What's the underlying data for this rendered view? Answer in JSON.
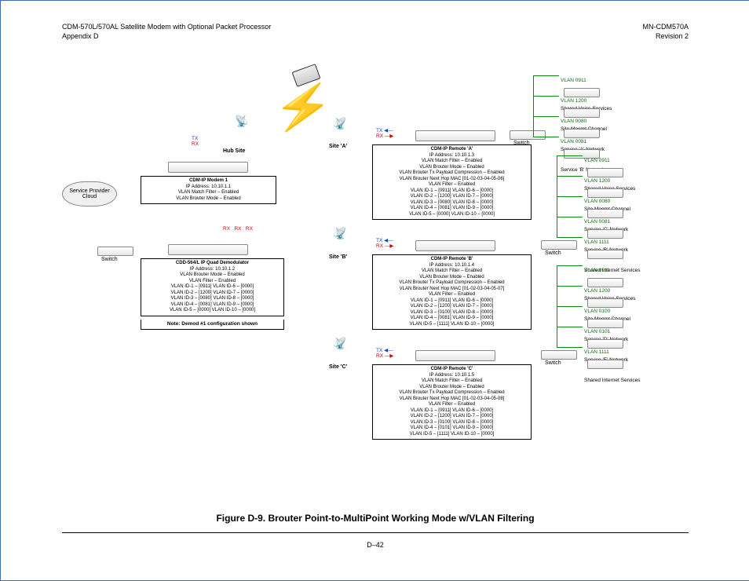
{
  "header": {
    "title": "CDM-570L/570AL Satellite Modem with Optional Packet Processor",
    "appendix": "Appendix D",
    "docnum": "MN-CDM570A",
    "rev": "Revision 2"
  },
  "caption": "Figure D-9. Brouter Point-to-MultiPoint Working Mode w/VLAN Filtering",
  "pagenum": "D–42",
  "cloud": "Service Provider Cloud",
  "labels": {
    "hub": "Hub Site",
    "switch": "Switch",
    "siteA": "Site 'A'",
    "siteB": "Site 'B'",
    "siteC": "Site 'C'",
    "tx": "TX",
    "rx": "RX"
  },
  "modem1": {
    "title": "CDM-IP Modem 1",
    "line1": "IP Address: 10.10.1.1",
    "line2": "VLAN Match Filter – Enabled",
    "line3": "VLAN Brouter Mode – Enabled"
  },
  "demod": {
    "title": "CDD-564/L IP Quad Demodulator",
    "line1": "IP Address: 10.10.1.2",
    "line2": "VLAN Brouter Mode – Enabled",
    "line3": "VLAN Filter – Enabled",
    "v1": "VLAN ID-1 – [0911]   VLAN ID-6 – [0000]",
    "v2": "VLAN ID-2 – [1200]   VLAN ID-7 – [0000]",
    "v3": "VLAN ID-3 – [0080]   VLAN ID-8 – [0000]",
    "v4": "VLAN ID-4 – [0081]   VLAN ID-9 – [0000]",
    "v5": "VLAN ID-5 – [0000]   VLAN ID-10 – [0000]",
    "note": "Note: Demod #1 configuration shown"
  },
  "remoteA": {
    "title": "CDM-IP Remote 'A'",
    "line1": "IP Address: 10.10.1.3",
    "line2": "VLAN Match Filter – Enabled",
    "line3": "VLAN Brouter Mode – Enabled",
    "line4": "VLAN Brouter Tx Payload Compression – Enabled",
    "line5": "VLAN Brouter Next Hop MAC [01-02-03-04-05-06]",
    "line6": "VLAN Filter – Enabled",
    "v1": "VLAN ID-1 – [0911]   VLAN ID-6 – [0000]",
    "v2": "VLAN ID-2 – [1200]   VLAN ID-7 – [0000]",
    "v3": "VLAN ID-3 – [0080]   VLAN ID-8 – [0000]",
    "v4": "VLAN ID-4 – [0081]   VLAN ID-9 – [0000]",
    "v5": "VLAN ID-5 – [0000]   VLAN ID-10 – [0000]"
  },
  "remoteB": {
    "title": "CDM-IP Remote 'B'",
    "line1": "IP Address: 10.10.1.4",
    "line2": "VLAN Match Filter – Enabled",
    "line3": "VLAN Brouter Mode – Enabled",
    "line4": "VLAN Brouter Tx Payload Compression – Enabled",
    "line5": "VLAN Brouter Next Hop MAC [01-02-03-04-05-07]",
    "line6": "VLAN Filter – Enabled",
    "v1": "VLAN ID-1 – [0911]   VLAN ID-6 – [0000]",
    "v2": "VLAN ID-2 – [1200]   VLAN ID-7 – [0000]",
    "v3": "VLAN ID-3 – [0100]   VLAN ID-8 – [0000]",
    "v4": "VLAN ID-4 – [0081]   VLAN ID-9 – [0000]",
    "v5": "VLAN ID-5 – [1111]   VLAN ID-10 – [0000]"
  },
  "remoteC": {
    "title": "CDM-IP Remote 'C'",
    "line1": "IP Address: 10.10.1.5",
    "line2": "VLAN Match Filter – Enabled",
    "line3": "VLAN Brouter Mode – Enabled",
    "line4": "VLAN Brouter Tx Payload Compression – Enabled",
    "line5": "VLAN Brouter Next Hop MAC [01-02-03-04-05-08]",
    "line6": "VLAN Filter – Enabled",
    "v1": "VLAN ID-1 – [0911]   VLAN ID-6 – [0000]",
    "v2": "VLAN ID-2 – [1200]   VLAN ID-7 – [0000]",
    "v3": "VLAN ID-3 – [0100]   VLAN ID-8 – [0000]",
    "v4": "VLAN ID-4 – [0101]   VLAN ID-9 – [0000]",
    "v5": "VLAN ID-5 – [1111]   VLAN ID-10 – [0000]"
  },
  "vlansA": [
    {
      "id": "VLAN 0911",
      "svc": "Shared Voice Services"
    },
    {
      "id": "VLAN 1200",
      "svc": "Site Mngmt Channel"
    },
    {
      "id": "VLAN 0080",
      "svc": "Service 'A' Network"
    },
    {
      "id": "VLAN 0081",
      "svc": "Service 'B' Network"
    }
  ],
  "vlansB": [
    {
      "id": "VLAN 0911",
      "svc": "Shared Voice Services"
    },
    {
      "id": "VLAN 1200",
      "svc": "Site Mngmt Channel"
    },
    {
      "id": "VLAN 0080",
      "svc": "Service 'C' Network"
    },
    {
      "id": "VLAN 0081",
      "svc": "Service 'B' Network"
    },
    {
      "id": "VLAN 1111",
      "svc": "Shared Internet Services"
    }
  ],
  "vlansC": [
    {
      "id": "VLAN 0911",
      "svc": "Shared Voice Services"
    },
    {
      "id": "VLAN 1200",
      "svc": "Site Mngmt Channel"
    },
    {
      "id": "VLAN 0100",
      "svc": "Service 'D' Network"
    },
    {
      "id": "VLAN 0101",
      "svc": "Service 'E' Network"
    },
    {
      "id": "VLAN 1111",
      "svc": "Shared Internet Services"
    }
  ]
}
